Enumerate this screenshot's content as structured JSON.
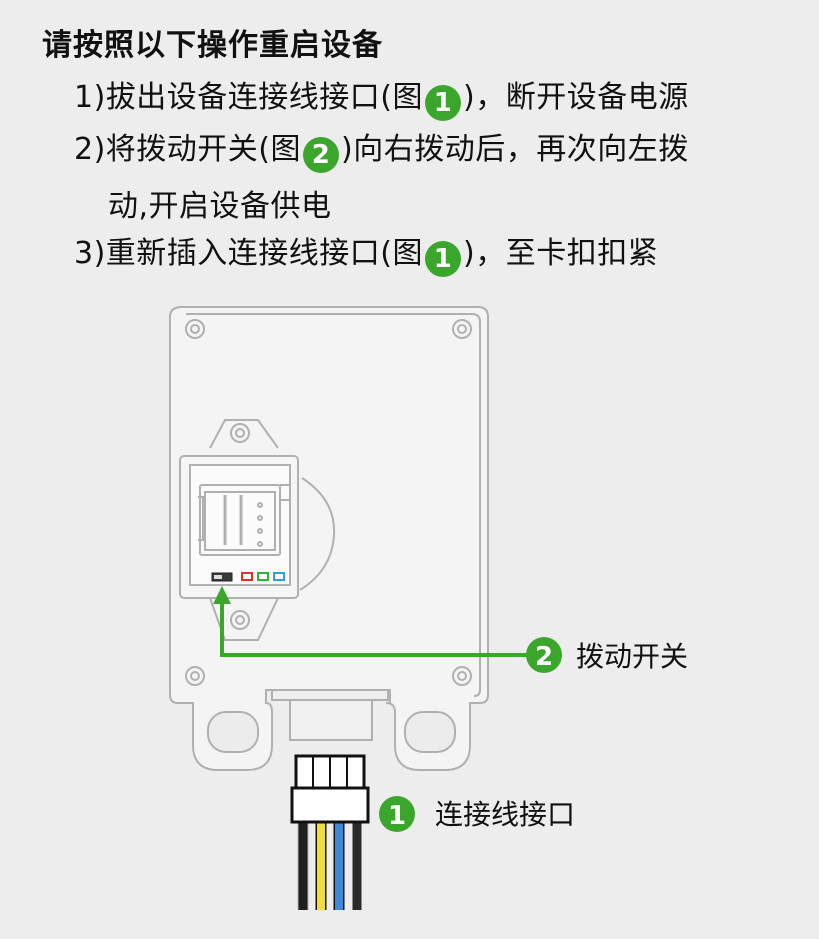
{
  "title": "请按照以下操作重启设备",
  "steps": [
    {
      "prefix": "1)拔出设备连接线接口(图",
      "badge": "1",
      "suffix": ")，断开设备电源"
    },
    {
      "prefix": "2)将拨动开关(图",
      "badge": "2",
      "suffix": ")向右拨动后，再次向左拨",
      "continuation": "动,开启设备供电"
    },
    {
      "prefix": "3)重新插入连接线接口(图",
      "badge": "1",
      "suffix": ")，至卡扣扣紧"
    }
  ],
  "callouts": {
    "switch": {
      "number": "2",
      "label": "拨动开关"
    },
    "connector": {
      "number": "1",
      "label": "连接线接口"
    }
  },
  "colors": {
    "accent_green": "#3aa62c",
    "wire_black": "#2b2b2b",
    "wire_yellow": "#f0dc3c",
    "wire_blue": "#3c8ad8",
    "led_red": "#e03030",
    "led_green": "#30b040",
    "led_blue": "#30a0e0"
  },
  "icons": [
    "arrow-up-icon",
    "number-badge-icon"
  ]
}
